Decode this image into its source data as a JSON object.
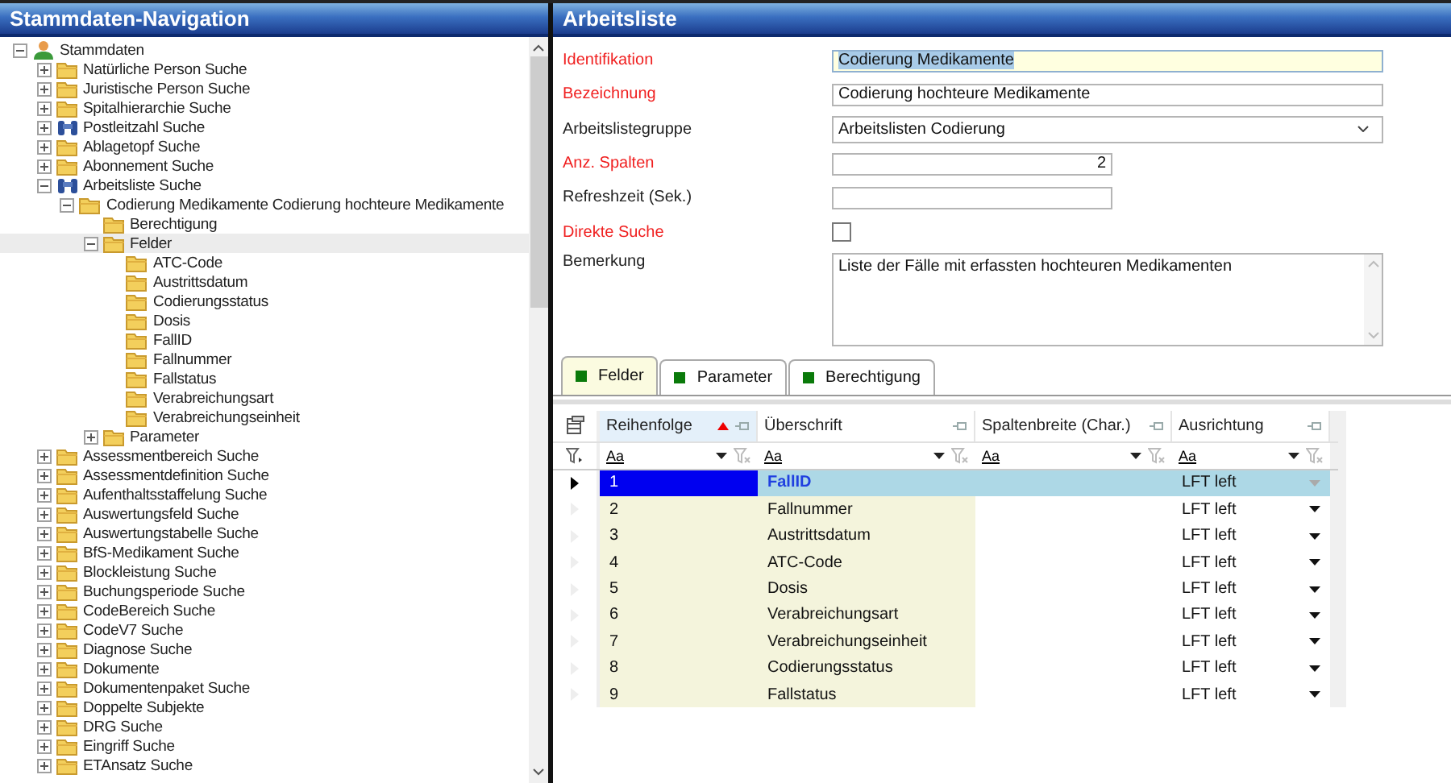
{
  "navigation": {
    "title": "Stammdaten-Navigation",
    "tree": [
      {
        "label": "Stammdaten",
        "kind": "root",
        "expanded": true,
        "selected": false,
        "children": [
          {
            "label": "Natürliche Person Suche",
            "kind": "folder",
            "expanded": false,
            "selected": false
          },
          {
            "label": "Juristische Person Suche",
            "kind": "folder",
            "expanded": false,
            "selected": false
          },
          {
            "label": "Spitalhierarchie Suche",
            "kind": "folder",
            "expanded": false,
            "selected": false
          },
          {
            "label": "Postleitzahl Suche",
            "kind": "binoculars",
            "expanded": false,
            "selected": false
          },
          {
            "label": "Ablagetopf Suche",
            "kind": "folder",
            "expanded": false,
            "selected": false
          },
          {
            "label": "Abonnement Suche",
            "kind": "folder",
            "expanded": false,
            "selected": false
          },
          {
            "label": "Arbeitsliste Suche",
            "kind": "binoculars",
            "expanded": true,
            "selected": false,
            "children": [
              {
                "label": "Codierung Medikamente Codierung hochteure Medikamente",
                "kind": "folder",
                "expanded": true,
                "selected": false,
                "children": [
                  {
                    "label": "Berechtigung",
                    "kind": "folder",
                    "selected": false
                  },
                  {
                    "label": "Felder",
                    "kind": "folder",
                    "expanded": true,
                    "selected": true,
                    "children": [
                      {
                        "label": "ATC-Code",
                        "kind": "folder",
                        "selected": false
                      },
                      {
                        "label": "Austrittsdatum",
                        "kind": "folder",
                        "selected": false
                      },
                      {
                        "label": "Codierungsstatus",
                        "kind": "folder",
                        "selected": false
                      },
                      {
                        "label": "Dosis",
                        "kind": "folder",
                        "selected": false
                      },
                      {
                        "label": "FallID",
                        "kind": "folder",
                        "selected": false
                      },
                      {
                        "label": "Fallnummer",
                        "kind": "folder",
                        "selected": false
                      },
                      {
                        "label": "Fallstatus",
                        "kind": "folder",
                        "selected": false
                      },
                      {
                        "label": "Verabreichungsart",
                        "kind": "folder",
                        "selected": false
                      },
                      {
                        "label": "Verabreichungseinheit",
                        "kind": "folder",
                        "selected": false
                      }
                    ]
                  },
                  {
                    "label": "Parameter",
                    "kind": "folder",
                    "expanded": false,
                    "selected": false
                  }
                ]
              }
            ]
          },
          {
            "label": "Assessmentbereich Suche",
            "kind": "folder",
            "expanded": false,
            "selected": false
          },
          {
            "label": "Assessmentdefinition Suche",
            "kind": "folder",
            "expanded": false,
            "selected": false
          },
          {
            "label": "Aufenthaltsstaffelung Suche",
            "kind": "folder",
            "expanded": false,
            "selected": false
          },
          {
            "label": "Auswertungsfeld Suche",
            "kind": "folder",
            "expanded": false,
            "selected": false
          },
          {
            "label": "Auswertungstabelle Suche",
            "kind": "folder",
            "expanded": false,
            "selected": false
          },
          {
            "label": "BfS-Medikament Suche",
            "kind": "folder",
            "expanded": false,
            "selected": false
          },
          {
            "label": "Blockleistung Suche",
            "kind": "folder",
            "expanded": false,
            "selected": false
          },
          {
            "label": "Buchungsperiode Suche",
            "kind": "folder",
            "expanded": false,
            "selected": false
          },
          {
            "label": "CodeBereich Suche",
            "kind": "folder",
            "expanded": false,
            "selected": false
          },
          {
            "label": "CodeV7 Suche",
            "kind": "folder",
            "expanded": false,
            "selected": false
          },
          {
            "label": "Diagnose Suche",
            "kind": "folder",
            "expanded": false,
            "selected": false
          },
          {
            "label": "Dokumente",
            "kind": "folder",
            "expanded": false,
            "selected": false
          },
          {
            "label": "Dokumentenpaket Suche",
            "kind": "folder",
            "expanded": false,
            "selected": false
          },
          {
            "label": "Doppelte Subjekte",
            "kind": "folder",
            "expanded": false,
            "selected": false
          },
          {
            "label": "DRG Suche",
            "kind": "folder",
            "expanded": false,
            "selected": false
          },
          {
            "label": "Eingriff Suche",
            "kind": "folder",
            "expanded": false,
            "selected": false
          },
          {
            "label": "ETAnsatz Suche",
            "kind": "folder",
            "expanded": false,
            "selected": false
          }
        ]
      }
    ]
  },
  "worklist": {
    "title": "Arbeitsliste",
    "fields": [
      {
        "label": "Identifikation",
        "kind": "text",
        "required": true,
        "focused": true,
        "value": "Codierung Medikamente"
      },
      {
        "label": "Bezeichnung",
        "kind": "text",
        "required": true,
        "focused": false,
        "value": "Codierung hochteure Medikamente"
      },
      {
        "label": "Arbeitslistegruppe",
        "kind": "select",
        "required": false,
        "focused": false,
        "value": "Arbeitslisten Codierung"
      },
      {
        "label": "Anz. Spalten",
        "kind": "number",
        "required": true,
        "focused": false,
        "value": "2"
      },
      {
        "label": "Refreshzeit (Sek.)",
        "kind": "number",
        "required": false,
        "focused": false
      },
      {
        "label": "Direkte Suche",
        "kind": "checkbox",
        "required": true,
        "checked": false
      },
      {
        "label": "Bemerkung",
        "kind": "textarea",
        "required": false,
        "focused": false,
        "value": "Liste der Fälle mit erfassten hochteuren Medikamenten"
      }
    ],
    "tabs": [
      {
        "label": "Felder",
        "selected": true
      },
      {
        "label": "Parameter",
        "selected": false
      },
      {
        "label": "Berechtigung",
        "selected": false
      }
    ],
    "grid": {
      "columns": [
        {
          "label": "Reihenfolge",
          "sorted": true,
          "filter_operator": "Aa"
        },
        {
          "label": "Überschrift",
          "sorted": false,
          "filter_operator": "Aa"
        },
        {
          "label": "Spaltenbreite (Char.)",
          "sorted": false,
          "filter_operator": "Aa"
        },
        {
          "label": "Ausrichtung",
          "sorted": false,
          "filter_operator": "Aa"
        }
      ],
      "rows": [
        {
          "order": "1",
          "heading": "FallID",
          "alignment": "LFT left",
          "selected": true
        },
        {
          "order": "2",
          "heading": "Fallnummer",
          "alignment": "LFT left",
          "selected": false
        },
        {
          "order": "3",
          "heading": "Austrittsdatum",
          "alignment": "LFT left",
          "selected": false
        },
        {
          "order": "4",
          "heading": "ATC-Code",
          "alignment": "LFT left",
          "selected": false
        },
        {
          "order": "5",
          "heading": "Dosis",
          "alignment": "LFT left",
          "selected": false
        },
        {
          "order": "6",
          "heading": "Verabreichungsart",
          "alignment": "LFT left",
          "selected": false
        },
        {
          "order": "7",
          "heading": "Verabreichungseinheit",
          "alignment": "LFT left",
          "selected": false
        },
        {
          "order": "8",
          "heading": "Codierungsstatus",
          "alignment": "LFT left",
          "selected": false
        },
        {
          "order": "9",
          "heading": "Fallstatus",
          "alignment": "LFT left",
          "selected": false
        }
      ]
    }
  }
}
